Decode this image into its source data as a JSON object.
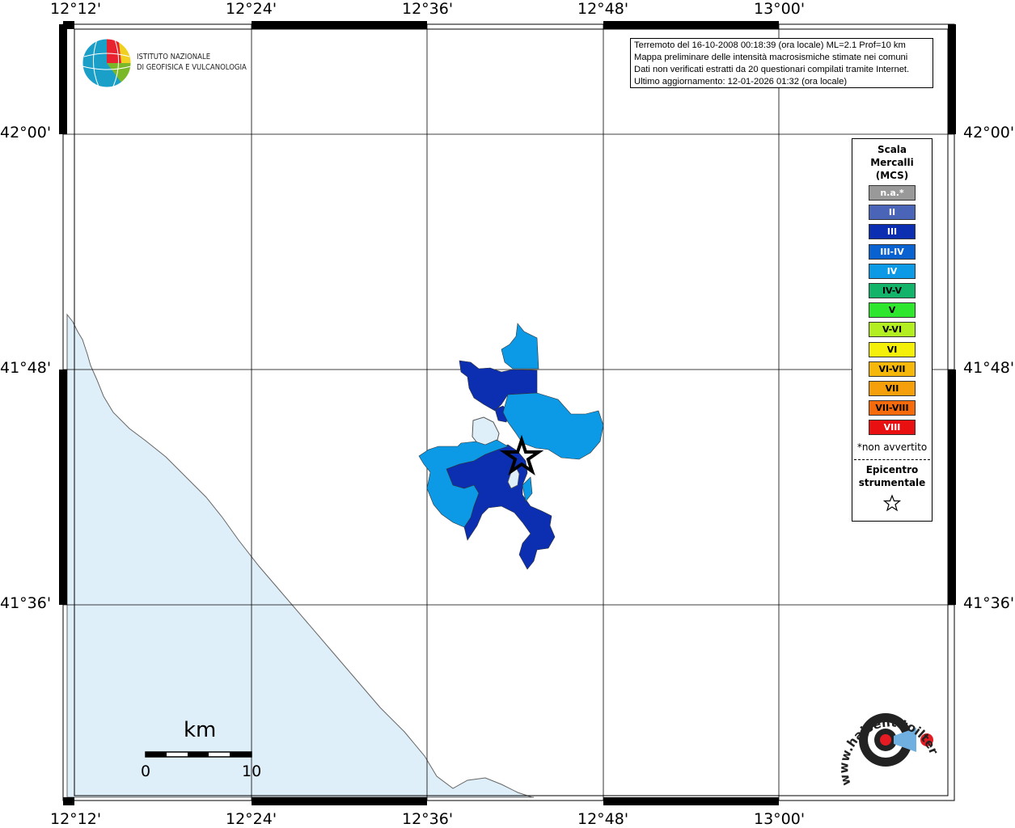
{
  "map": {
    "lon_labels": [
      "12°12'",
      "12°24'",
      "12°36'",
      "12°48'",
      "13°00'"
    ],
    "lat_labels": [
      "42°00'",
      "41°48'",
      "41°36'"
    ],
    "info_lines": [
      "Terremoto del 16-10-2008 00:18:39 (ora locale) ML=2.1 Prof=10 km",
      "Mappa preliminare delle intensità macrosismiche stimate nei comuni",
      "Dati non verificati estratti da 20 questionari compilati tramite Internet.",
      "Ultimo aggiornamento: 12-01-2026 01:32 (ora locale)"
    ],
    "logo": {
      "line1": "ISTITUTO NAZIONALE",
      "line2": "DI GEOFISICA E VULCANOLOGIA"
    },
    "scalebar": {
      "title": "km",
      "start": "0",
      "end": "10"
    },
    "watermark": "www.haisentitoilterremoto.it",
    "colors": {
      "sea": "#dfeffa",
      "coast": "#666666",
      "epicenter": "#000000"
    }
  },
  "legend": {
    "title_lines": [
      "Scala",
      "Mercalli",
      "(MCS)"
    ],
    "items": [
      {
        "label": "n.a.*",
        "color": "#999999",
        "text": "#ffffff"
      },
      {
        "label": "II",
        "color": "#4a64b8",
        "text": "#ffffff"
      },
      {
        "label": "III",
        "color": "#0b2fb0",
        "text": "#ffffff"
      },
      {
        "label": "III-IV",
        "color": "#0a62d0",
        "text": "#ffffff"
      },
      {
        "label": "IV",
        "color": "#0c9ae6",
        "text": "#ffffff"
      },
      {
        "label": "IV-V",
        "color": "#14b36a",
        "text": "#000000"
      },
      {
        "label": "V",
        "color": "#2ee62e",
        "text": "#000000"
      },
      {
        "label": "V-VI",
        "color": "#b2ee22",
        "text": "#000000"
      },
      {
        "label": "VI",
        "color": "#f5f00a",
        "text": "#000000"
      },
      {
        "label": "VI-VII",
        "color": "#f5b80a",
        "text": "#000000"
      },
      {
        "label": "VII",
        "color": "#f5a00a",
        "text": "#000000"
      },
      {
        "label": "VII-VIII",
        "color": "#f56a0a",
        "text": "#000000"
      },
      {
        "label": "VIII",
        "color": "#e81010",
        "text": "#ffffff"
      }
    ],
    "note": "*non avvertito",
    "epicenter_lines": [
      "Epicentro",
      "strumentale"
    ]
  },
  "areas": [
    {
      "intensity": "III",
      "color": "#0b2fb0"
    },
    {
      "intensity": "IV",
      "color": "#0c9ae6"
    }
  ]
}
